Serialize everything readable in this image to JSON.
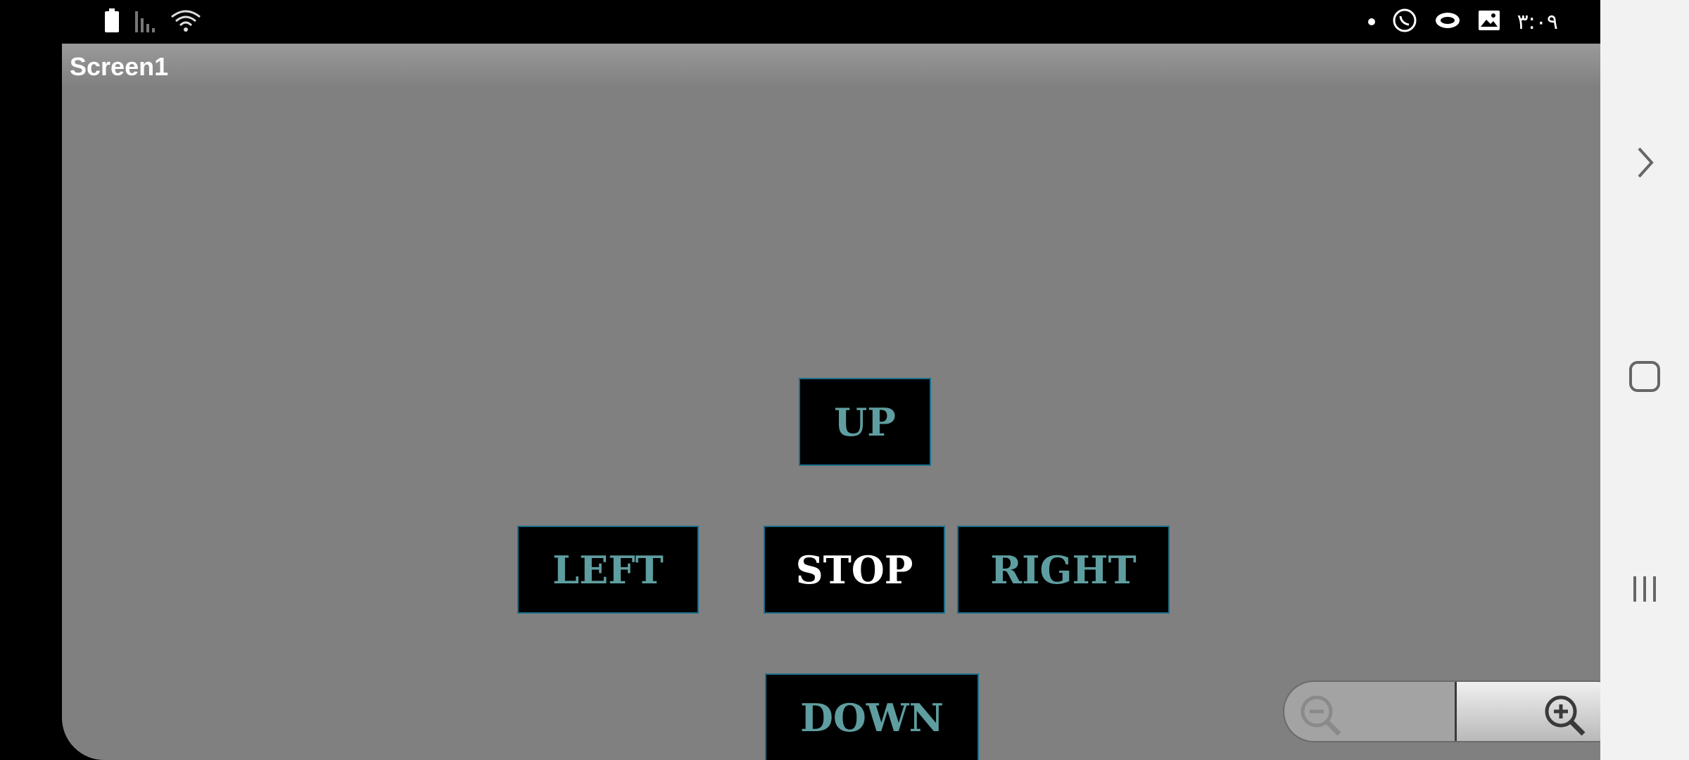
{
  "status_bar": {
    "time": "٣:٠٩"
  },
  "screen": {
    "title": "Screen1"
  },
  "buttons": {
    "up": "UP",
    "left": "LEFT",
    "stop": "STOP",
    "right": "RIGHT",
    "down": "DOWN"
  },
  "colors": {
    "background": "#808080",
    "button_bg": "#000000",
    "button_text": "#5f9ea0",
    "stop_text": "#ffffff",
    "button_border": "#1a6d8a"
  }
}
